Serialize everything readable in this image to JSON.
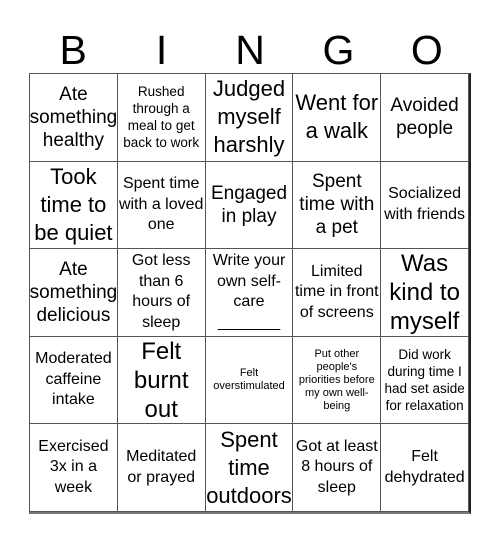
{
  "header": {
    "letters": [
      "B",
      "I",
      "N",
      "G",
      "O"
    ]
  },
  "card": {
    "cells": [
      {
        "text": "Ate something healthy",
        "size": "lg"
      },
      {
        "text": "Rushed through a meal to get back to work",
        "size": "sm"
      },
      {
        "text": "Judged myself harshly",
        "size": "xl"
      },
      {
        "text": "Went for a walk",
        "size": "xl"
      },
      {
        "text": "Avoided people",
        "size": "lg"
      },
      {
        "text": "Took time to be quiet",
        "size": "xl"
      },
      {
        "text": "Spent time with a loved one",
        "size": "md"
      },
      {
        "text": "Engaged in play",
        "size": "lg"
      },
      {
        "text": "Spent time with a pet",
        "size": "lg"
      },
      {
        "text": "Socialized with friends",
        "size": "md"
      },
      {
        "text": "Ate something delicious",
        "size": "lg"
      },
      {
        "text": "Got less than 6 hours of sleep",
        "size": "md"
      },
      {
        "text": "Write your own self-care _______",
        "size": "md"
      },
      {
        "text": "Limited time in front of screens",
        "size": "md"
      },
      {
        "text": "Was kind to myself",
        "size": "xxl"
      },
      {
        "text": "Moderated caffeine intake",
        "size": "md"
      },
      {
        "text": "Felt burnt out",
        "size": "xxl"
      },
      {
        "text": "Felt overstimulated",
        "size": "xs"
      },
      {
        "text": "Put other people's priorities before my own well-being",
        "size": "xs"
      },
      {
        "text": "Did work during time I had set aside for relaxation",
        "size": "sm"
      },
      {
        "text": "Exercised 3x in a week",
        "size": "md"
      },
      {
        "text": "Meditated or prayed",
        "size": "md"
      },
      {
        "text": "Spent time outdoors",
        "size": "xl"
      },
      {
        "text": "Got at least 8 hours of sleep",
        "size": "md"
      },
      {
        "text": "Felt dehydrated",
        "size": "md"
      }
    ]
  }
}
